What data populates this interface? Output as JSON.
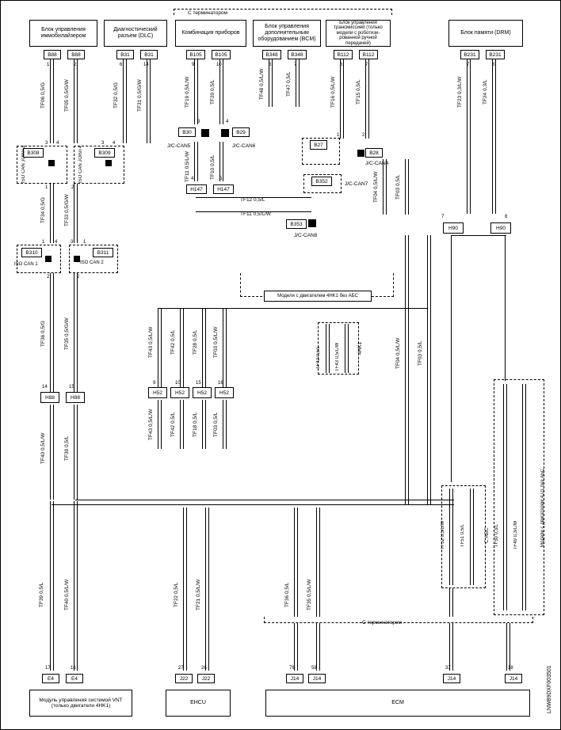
{
  "headers": {
    "term_top": "С терминатором",
    "term_bottom": "С терминатором",
    "blk_immo": "Блок управления иммобилайзером",
    "blk_diag": "Диагностический разъем (DLC)",
    "blk_comb": "Комбинация приборов",
    "blk_bcm": "Блок управления дополнительным оборудованием (BCM)",
    "blk_trans": "Блок управления трансмиссией (только модели с роботизи-рованной ручной передачей)",
    "blk_drm": "Блок памяти (DRM)",
    "blk_vnt": "Модуль управления системой VNT (только двигатели 4HK1)",
    "blk_ehcu": "EHCU",
    "blk_ecm": "ECM",
    "note_4hk1_abs": "Модели с двигателем 4HK1 без АБС",
    "note_4jj1_abs": "Модели с двигателем 4JJ1 без АБС",
    "note_4hk1": "4HK1",
    "note_cabs": "С АБС"
  },
  "docid": "LNW89DXF003501",
  "connectors": {
    "B88a": "B88",
    "B88b": "B88",
    "B31a": "B31",
    "B31b": "B31",
    "B105a": "B105",
    "B105b": "B105",
    "B348a": "B348",
    "B348b": "B348",
    "B112a": "B112",
    "B112b": "B112",
    "B231a": "B231",
    "B231b": "B231",
    "B308": "B308",
    "B309": "B309",
    "B30": "B30",
    "B29": "B29",
    "B27": "B27",
    "B28": "B28",
    "B310": "B310",
    "B311": "B311",
    "B352": "B352",
    "B353": "B353",
    "H147a": "H147",
    "H147b": "H147",
    "H90a": "H90",
    "H90b": "H90",
    "H88a": "H88",
    "H88b": "H88",
    "H52a": "H52",
    "H52b": "H52",
    "H52c": "H52",
    "H52d": "H52",
    "E4a": "E4",
    "E4b": "E4",
    "J22a": "J22",
    "J22b": "J22",
    "J14a": "J14",
    "J14b": "J14",
    "J14c": "J14",
    "J14d": "J14"
  },
  "labels": {
    "iso_joint3": "ISO CAN JOINT3",
    "iso_joint4": "ISO CAN JOINT4",
    "iso_can1": "ISO CAN 1",
    "iso_can2": "ISO CAN 2",
    "jc_can5": "J/C-CAN5",
    "jc_can6": "J/C-CAN6",
    "jc_can4": "J/C-CAN4",
    "jc_can7": "J/C-CAN7",
    "jc_can8": "J/C-CAN8"
  },
  "wires": {
    "tf06": "TF06 0,5/G",
    "tf05": "TF05 0,5/G/W",
    "tf32": "TF32 0,5/G",
    "tf31": "TF31 0,5/G/W",
    "tf23": "TF23 0,3/L/W",
    "tf24": "TF24 0,3/L",
    "tf19": "TF19 0,5/L/W",
    "tf20": "TF20 0,5/L",
    "tf48": "TF48 0,5/L/W",
    "tf47": "TF47 0,5/L",
    "tf16": "TF16 0,5/L/W",
    "tf15": "TF15 0,5/L",
    "tf34": "TF34 0,5/G",
    "tf33": "TF33 0,5/G/W",
    "tf11": "TF11 0,5/L/W",
    "tf10": "TF10 0,5/L",
    "tf12": "TF12 0,5/L",
    "tf11b": "TF11 0,5/L/W",
    "tf04": "TF04 0,5/L/W",
    "tf03": "TF03 0,5/L",
    "tf36": "TF36 0,5/G",
    "tf35": "TF35 0,5/G/W",
    "tf43": "TF43 0,5/L/W",
    "tf42": "TF42 0,5/L",
    "tf28": "TF28 0,5/L",
    "tf03b": "TF03 0,5/L/W",
    "tf21": "TF21 0,5/L/W",
    "tf22": "TF22 0,5/L",
    "tf35b": "TF35 0,5/L/W",
    "tf36b": "TF36 0,5/L",
    "tf39": "TF39 0,5/L",
    "tf40": "TF40 0,5/L/W",
    "tf18": "TF18 0,5/L",
    "tf43b": "TF43 0,5/L/W",
    "tf42b": "TF42 0,5/L",
    "tf03c": "TF03 0,5/L",
    "tf52": "TF52 0,5/L/W",
    "tf51": "TF51 0,5/L",
    "tf50": "TF50 0,3/L",
    "tf49": "TF49 0,3/L/W"
  },
  "pins": {
    "p1": "1",
    "p2": "2",
    "p3": "3",
    "p4": "4",
    "p5": "5",
    "p6": "6",
    "p7": "7",
    "p8": "8",
    "p9": "9",
    "p10": "10",
    "p12": "12",
    "p14": "14",
    "p15": "15",
    "p16": "16",
    "p17": "17",
    "p18": "18",
    "p26": "26",
    "p27": "27",
    "p37": "37",
    "p58": "58",
    "p78": "78"
  }
}
